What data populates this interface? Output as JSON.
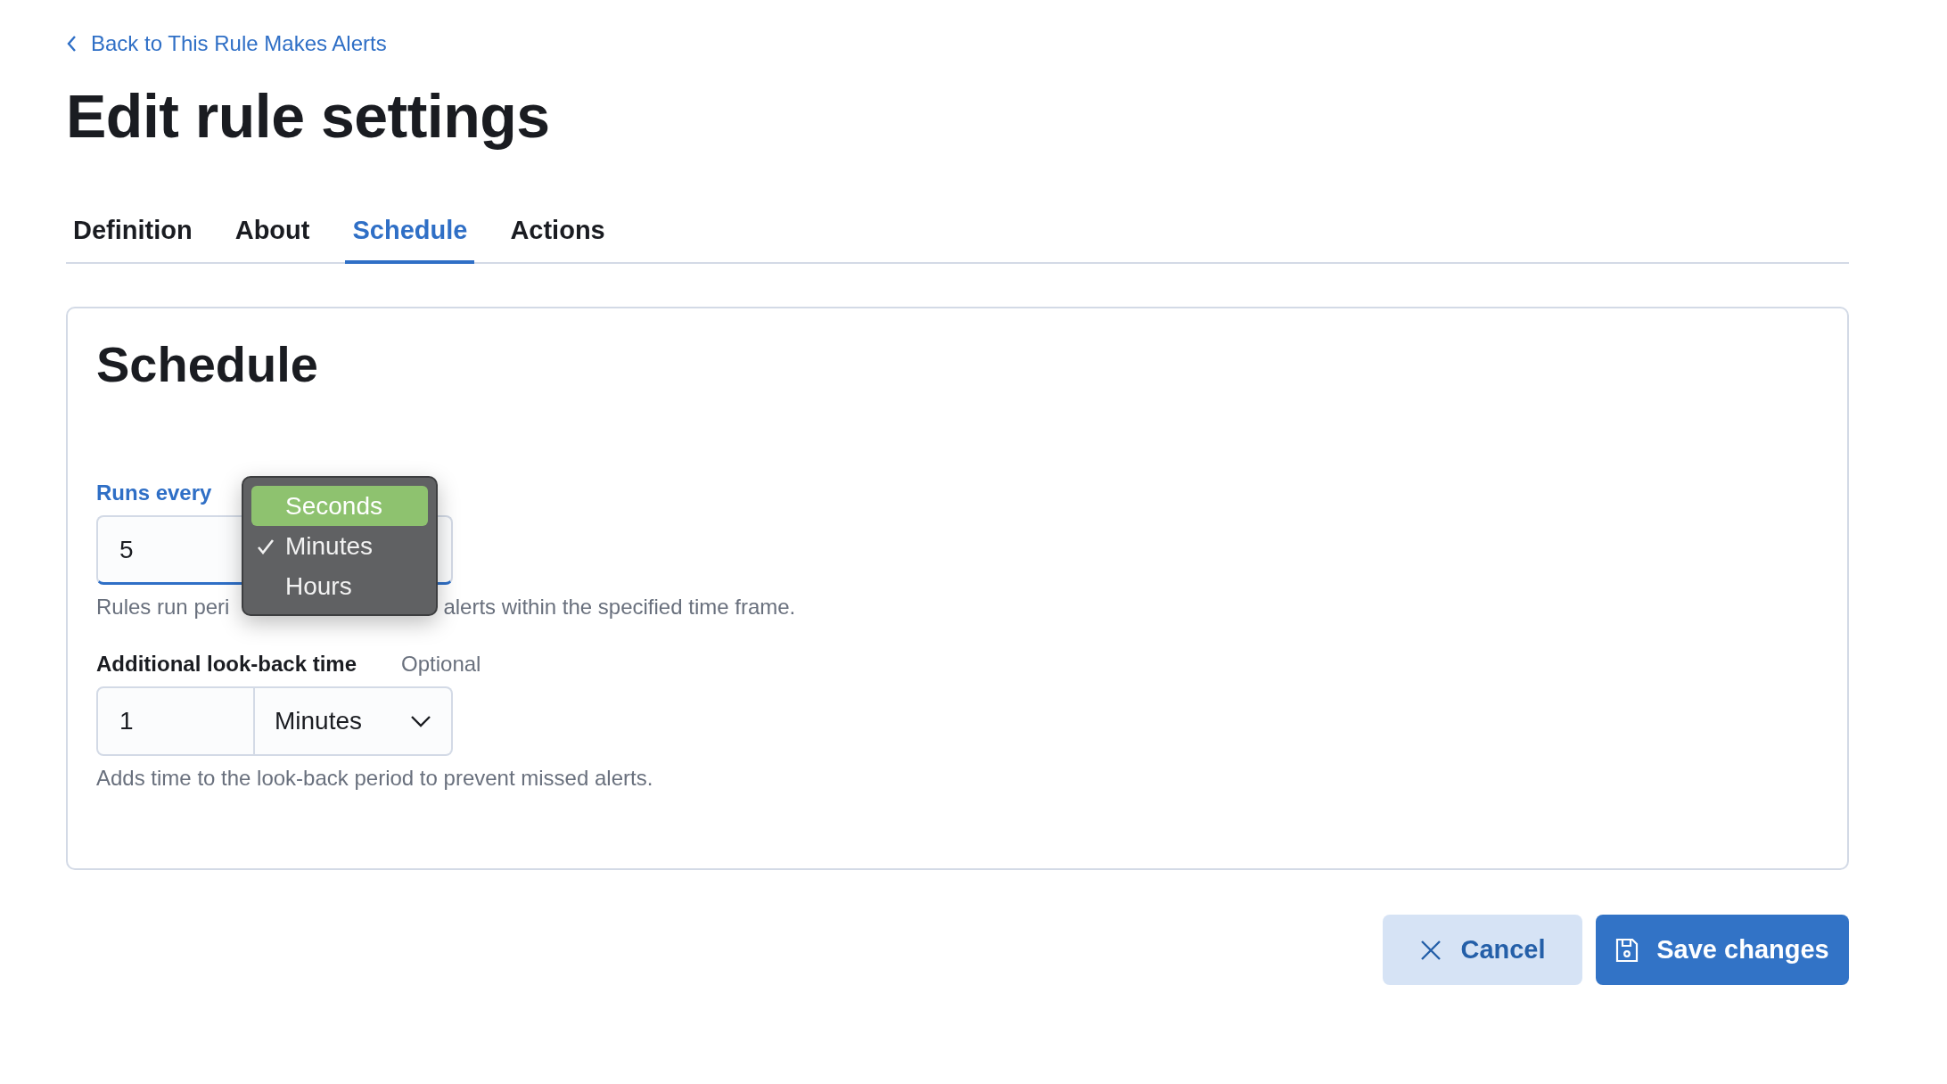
{
  "back_link": {
    "label": "Back to This Rule Makes Alerts"
  },
  "title": "Edit rule settings",
  "tabs": [
    {
      "label": "Definition",
      "selected": false
    },
    {
      "label": "About",
      "selected": false
    },
    {
      "label": "Schedule",
      "selected": true
    },
    {
      "label": "Actions",
      "selected": false
    }
  ],
  "panel": {
    "title": "Schedule",
    "runs_every": {
      "label": "Runs every",
      "focused": true,
      "value": "5",
      "help_visible": [
        "Rules run peri",
        "alerts within the specified time frame."
      ]
    },
    "unit_menu": {
      "items": [
        {
          "label": "Seconds",
          "checked": false,
          "highlighted": true
        },
        {
          "label": "Minutes",
          "checked": true,
          "highlighted": false
        },
        {
          "label": "Hours",
          "checked": false,
          "highlighted": false
        }
      ]
    },
    "look_back": {
      "label": "Additional look-back time",
      "focused": false,
      "optional": "Optional",
      "value": "1",
      "unit": "Minutes",
      "help": "Adds time to the look-back period to prevent missed alerts."
    }
  },
  "buttons": [
    {
      "kind": "secondary",
      "label": "Cancel"
    },
    {
      "kind": "primary",
      "label": "Save changes"
    }
  ]
}
